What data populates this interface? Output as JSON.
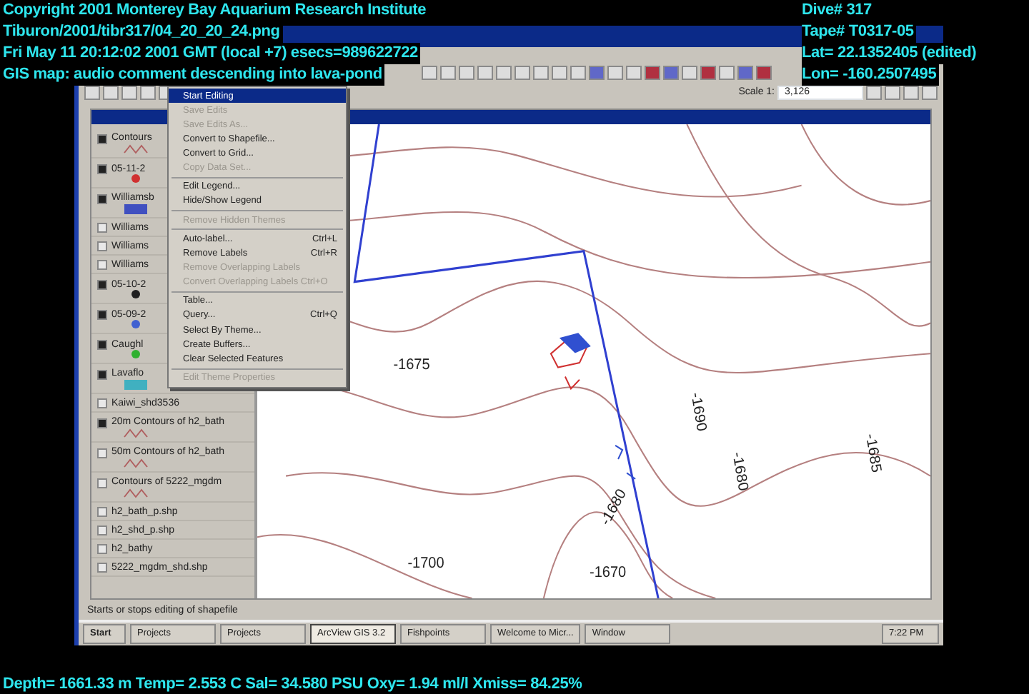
{
  "overlay": {
    "top_left": [
      "Copyright 2001 Monterey Bay Aquarium Research Institute",
      "Tiburon/2001/tibr317/04_20_20_24.png",
      "Fri May 11 20:12:02 2001 GMT (local +7)  esecs=989622722",
      "GIS map: audio comment descending into lava-pond"
    ],
    "top_right": [
      "Dive# 317",
      "Tape# T0317-05",
      "Lat= 22.1352405 (edited)",
      "Lon= -160.2507495"
    ],
    "bottom": "Depth= 1661.33 m  Temp= 2.553 C  Sal= 34.580 PSU  Oxy= 1.94 ml/l  Xmiss= 84.25%"
  },
  "toolbar": {
    "scale_label": "Scale 1:",
    "scale_value": "3,126"
  },
  "legend": [
    {
      "label": "Contours",
      "checked": true,
      "kind": "line"
    },
    {
      "label": "05-11-2",
      "checked": true,
      "kind": "dot",
      "color": "#d03030"
    },
    {
      "label": "Williamsb",
      "checked": true,
      "kind": "fill",
      "color": "#4050c0"
    },
    {
      "label": "Williams",
      "checked": false
    },
    {
      "label": "Williams",
      "checked": false
    },
    {
      "label": "Williams",
      "checked": false
    },
    {
      "label": "05-10-2",
      "checked": true,
      "kind": "dot",
      "color": "#202020"
    },
    {
      "label": "05-09-2",
      "checked": true,
      "kind": "dot",
      "color": "#4060d0"
    },
    {
      "label": "Caughl",
      "checked": true,
      "kind": "dot",
      "color": "#30b030"
    },
    {
      "label": "Lavaflo",
      "checked": true,
      "kind": "fill",
      "color": "#40b0c0"
    },
    {
      "label": "Kaiwi_shd3536",
      "checked": false
    },
    {
      "label": "20m Contours of h2_bath",
      "checked": true,
      "kind": "line"
    },
    {
      "label": "50m Contours of h2_bath",
      "checked": false,
      "kind": "line"
    },
    {
      "label": "Contours of 5222_mgdm",
      "checked": false,
      "kind": "line"
    },
    {
      "label": "h2_bath_p.shp",
      "checked": false
    },
    {
      "label": "h2_shd_p.shp",
      "checked": false
    },
    {
      "label": "h2_bathy",
      "checked": false
    },
    {
      "label": "5222_mgdm_shd.shp",
      "checked": false
    }
  ],
  "context_menu": [
    {
      "label": "Start Editing",
      "selected": true,
      "disabled": false
    },
    {
      "label": "Save Edits",
      "selected": false,
      "disabled": true
    },
    {
      "label": "Save Edits As...",
      "selected": false,
      "disabled": true
    },
    {
      "label": "Convert to Shapefile...",
      "selected": false,
      "disabled": false
    },
    {
      "label": "Convert to Grid...",
      "selected": false,
      "disabled": false
    },
    {
      "label": "Copy Data Set...",
      "selected": false,
      "disabled": true,
      "separator_after": true
    },
    {
      "label": "Edit Legend...",
      "selected": false,
      "disabled": false
    },
    {
      "label": "Hide/Show Legend",
      "selected": false,
      "disabled": false,
      "separator_after": true
    },
    {
      "label": "Remove Hidden Themes",
      "selected": false,
      "disabled": true,
      "separator_after": true
    },
    {
      "label": "Auto-label...",
      "shortcut": "Ctrl+L",
      "selected": false,
      "disabled": false
    },
    {
      "label": "Remove Labels",
      "shortcut": "Ctrl+R",
      "selected": false,
      "disabled": false
    },
    {
      "label": "Remove Overlapping Labels",
      "selected": false,
      "disabled": true
    },
    {
      "label": "Convert Overlapping Labels  Ctrl+O",
      "selected": false,
      "disabled": true,
      "separator_after": true
    },
    {
      "label": "Table...",
      "selected": false,
      "disabled": false
    },
    {
      "label": "Query...",
      "shortcut": "Ctrl+Q",
      "selected": false,
      "disabled": false
    },
    {
      "label": "Select By Theme...",
      "selected": false,
      "disabled": false
    },
    {
      "label": "Create Buffers...",
      "selected": false,
      "disabled": false
    },
    {
      "label": "Clear Selected Features",
      "selected": false,
      "disabled": false,
      "separator_after": true
    },
    {
      "label": "Edit Theme Properties",
      "selected": false,
      "disabled": true
    }
  ],
  "map_labels": [
    "-1675",
    "-1690",
    "-1680",
    "-1685",
    "-1680",
    "-1670",
    "-1700"
  ],
  "status_bar": "Starts or stops editing of shapefile",
  "taskbar": {
    "start": "Start",
    "tasks": [
      {
        "label": "Projects",
        "selected": false
      },
      {
        "label": "Projects",
        "selected": false
      },
      {
        "label": "ArcView GIS 3.2",
        "selected": true
      },
      {
        "label": "Fishpoints",
        "selected": false
      },
      {
        "label": "Welcome to Micr...",
        "selected": false
      },
      {
        "label": "Window",
        "selected": false
      }
    ],
    "clock": "7:22 PM"
  }
}
